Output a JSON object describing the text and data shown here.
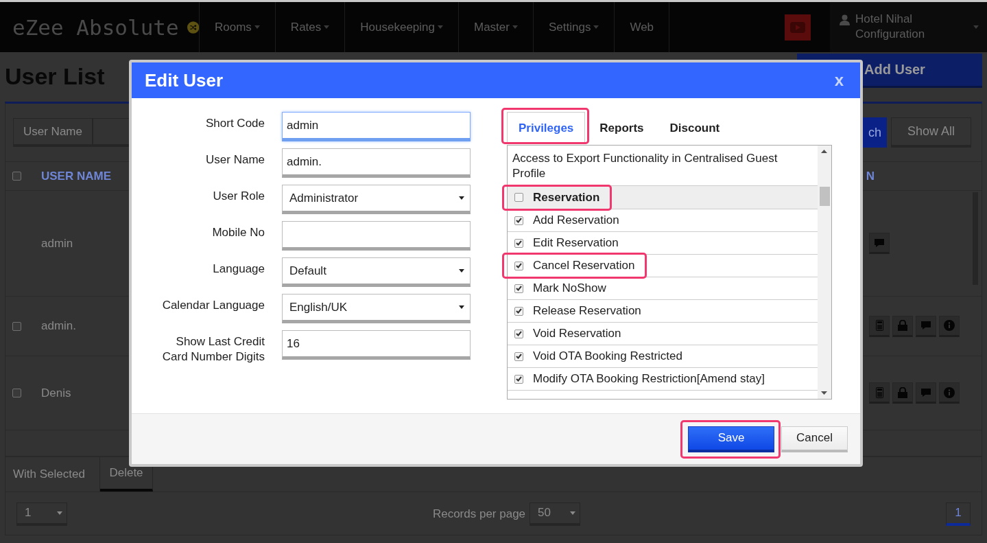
{
  "header": {
    "logo": "eZee Absolute",
    "nav": [
      {
        "label": "Rooms",
        "dropdown": true
      },
      {
        "label": "Rates",
        "dropdown": true
      },
      {
        "label": "Housekeeping",
        "dropdown": true
      },
      {
        "label": "Master",
        "dropdown": true
      },
      {
        "label": "Settings",
        "dropdown": true
      },
      {
        "label": "Web",
        "dropdown": false
      }
    ],
    "user": {
      "name": "Hotel Nihal",
      "role": "Configuration"
    }
  },
  "page": {
    "title": "User List",
    "add_button": "Add User"
  },
  "search": {
    "label": "User Name",
    "search_button": "ch",
    "show_all_button": "Show All"
  },
  "table": {
    "select_all": {
      "checked": false
    },
    "columns": [
      "USER NAME",
      "N"
    ],
    "rows": [
      {
        "name": "admin",
        "actions": [
          {
            "kind": "chat"
          }
        ]
      },
      {
        "name": "admin.",
        "checked": false,
        "actions": [
          {
            "kind": "calculator"
          },
          {
            "kind": "lock"
          },
          {
            "kind": "chat"
          },
          {
            "kind": "info"
          }
        ]
      },
      {
        "name": "Denis",
        "checked": false,
        "actions": [
          {
            "kind": "calculator"
          },
          {
            "kind": "lock"
          },
          {
            "kind": "chat"
          },
          {
            "kind": "info"
          }
        ]
      }
    ]
  },
  "footer": {
    "bulk_label": "With Selected",
    "delete_button": "Delete",
    "page_select": "1",
    "records_label": "Records per page",
    "records_select": "50",
    "pages": [
      {
        "label": "1",
        "selected": true
      }
    ]
  },
  "modal": {
    "title": "Edit User",
    "close": "x",
    "fields": [
      {
        "label": "Short Code",
        "kind": "text",
        "value": "admin",
        "focused": true
      },
      {
        "label": "User Name",
        "kind": "text",
        "value": "admin.",
        "focused": false
      },
      {
        "label": "User Role",
        "kind": "select",
        "value": "Administrator",
        "focused": false
      },
      {
        "label": "Mobile No",
        "kind": "text",
        "focused": false
      },
      {
        "label": "Language",
        "kind": "select",
        "value": "Default",
        "focused": false
      },
      {
        "label": "Calendar Language",
        "kind": "select",
        "value": "English/UK",
        "focused": false
      },
      {
        "label": "Show Last Credit Card Number Digits",
        "kind": "text",
        "value": "16",
        "focused": false
      }
    ],
    "tabs": [
      {
        "label": "Privileges",
        "selected": true,
        "highlighted": true
      },
      {
        "label": "Reports",
        "selected": false,
        "highlighted": false
      },
      {
        "label": "Discount",
        "selected": false,
        "highlighted": false
      }
    ],
    "privileges": [
      {
        "kind": "text",
        "label": "Access to Export Functionality in Centralised Guest Profile"
      },
      {
        "kind": "group",
        "label": "Reservation",
        "checked": false,
        "highlighted": true
      },
      {
        "kind": "item",
        "label": "Add Reservation",
        "checked": true,
        "highlighted": false
      },
      {
        "kind": "item",
        "label": "Edit Reservation",
        "checked": true,
        "highlighted": false
      },
      {
        "kind": "item",
        "label": "Cancel Reservation",
        "checked": true,
        "highlighted": true
      },
      {
        "kind": "item",
        "label": "Mark NoShow",
        "checked": true,
        "highlighted": false
      },
      {
        "kind": "item",
        "label": "Release Reservation",
        "checked": true,
        "highlighted": false
      },
      {
        "kind": "item",
        "label": "Void Reservation",
        "checked": true,
        "highlighted": false
      },
      {
        "kind": "item",
        "label": "Void OTA Booking Restricted",
        "checked": true,
        "highlighted": false
      },
      {
        "kind": "item",
        "label": "Modify OTA Booking Restriction[Amend stay]",
        "checked": true,
        "highlighted": false
      }
    ],
    "buttons": [
      {
        "label": "Save",
        "kind": "primary",
        "highlighted": true
      },
      {
        "label": "Cancel",
        "kind": "secondary",
        "highlighted": false
      }
    ]
  }
}
